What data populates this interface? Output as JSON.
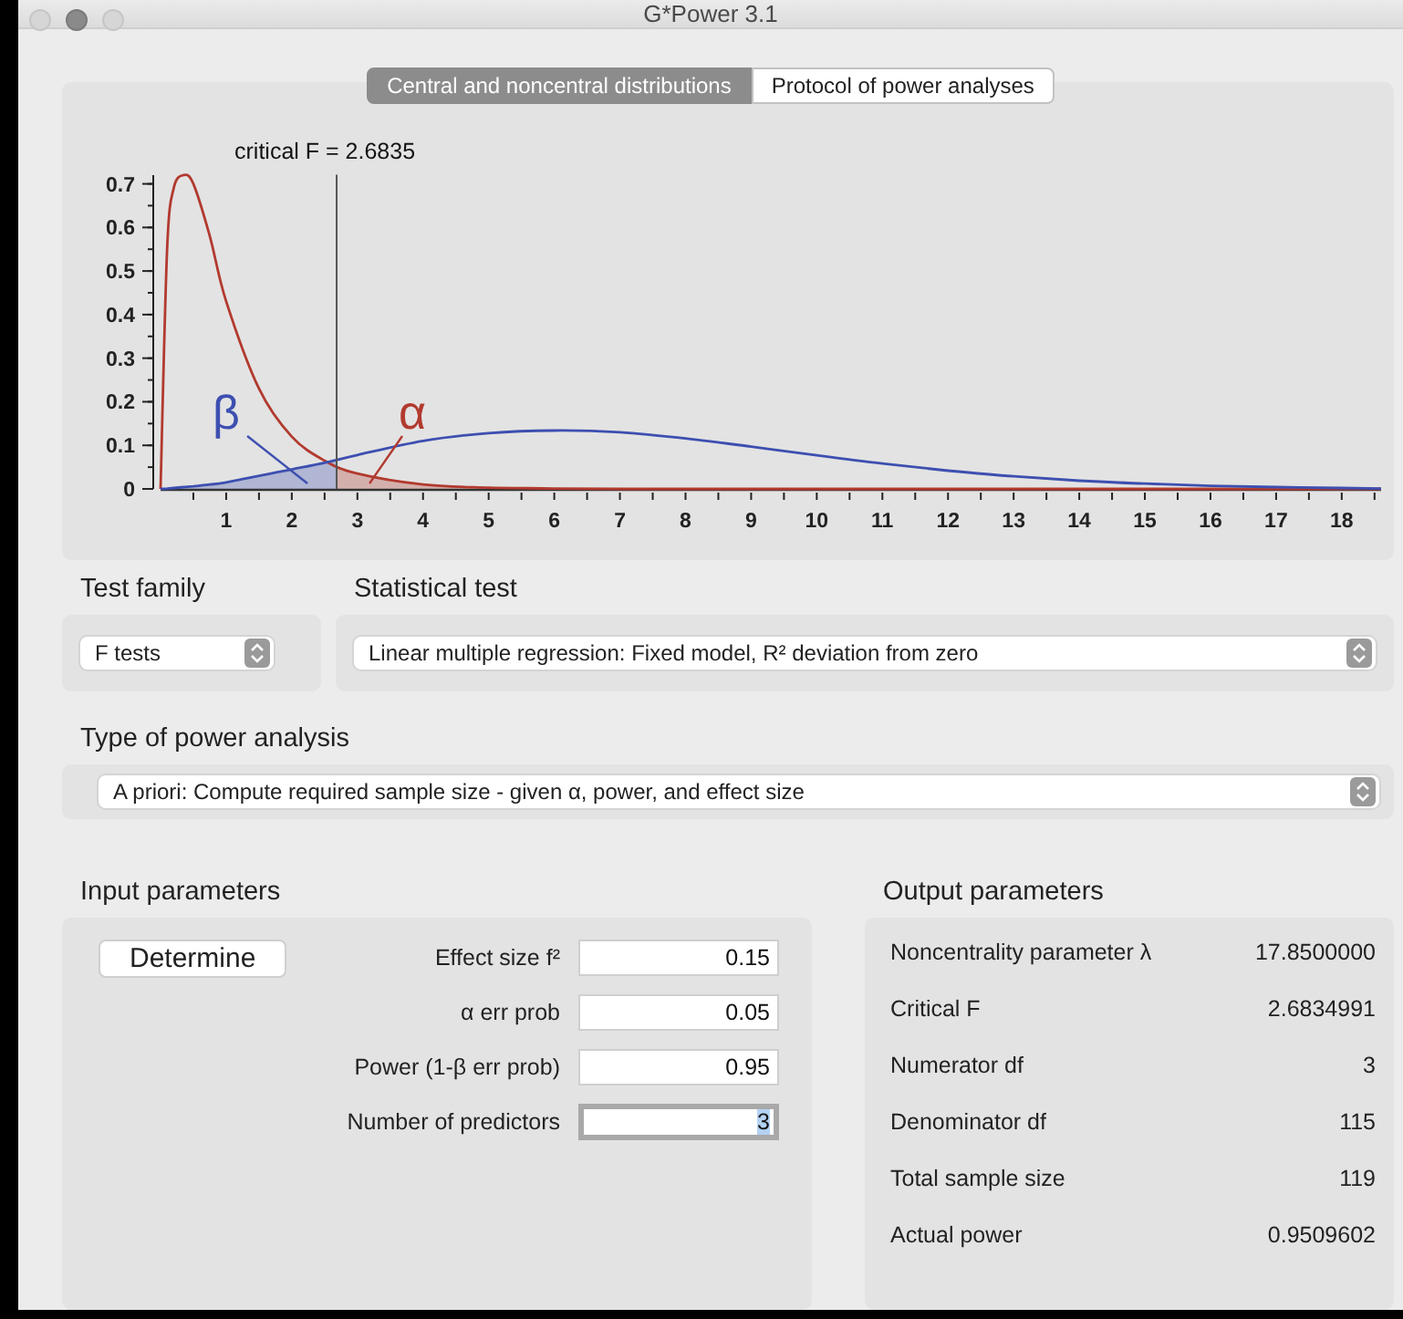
{
  "window": {
    "title": "G*Power 3.1"
  },
  "tabs": [
    {
      "label": "Central and noncentral distributions",
      "selected": true
    },
    {
      "label": "Protocol of power analyses",
      "selected": false
    }
  ],
  "chart_data": {
    "type": "line",
    "x": [
      0,
      0.1,
      0.2,
      0.35,
      0.5,
      0.75,
      1,
      1.5,
      2,
      2.5,
      3,
      4,
      5,
      6,
      7,
      8,
      9,
      10,
      11,
      12,
      13,
      14,
      15,
      16,
      17,
      18,
      18.6
    ],
    "series": [
      {
        "color": "#b23a2f",
        "values": [
          0,
          0.55,
          0.69,
          0.72,
          0.7,
          0.58,
          0.43,
          0.23,
          0.12,
          0.065,
          0.035,
          0.01,
          0.003,
          0.001,
          0,
          0,
          0,
          0,
          0,
          0,
          0,
          0,
          0,
          0,
          0,
          0,
          0
        ]
      },
      {
        "color": "#3d4fb0",
        "values": [
          0,
          0.001,
          0.002,
          0.004,
          0.006,
          0.01,
          0.015,
          0.03,
          0.045,
          0.06,
          0.078,
          0.11,
          0.128,
          0.134,
          0.13,
          0.116,
          0.097,
          0.077,
          0.058,
          0.042,
          0.029,
          0.019,
          0.012,
          0.007,
          0.004,
          0.002,
          0.001
        ]
      }
    ],
    "xlim": [
      0,
      18.6
    ],
    "ylim": [
      0,
      0.72
    ],
    "xticks": [
      1,
      2,
      3,
      4,
      5,
      6,
      7,
      8,
      9,
      10,
      11,
      12,
      13,
      14,
      15,
      16,
      17,
      18
    ],
    "yticks": [
      0,
      0.1,
      0.2,
      0.3,
      0.4,
      0.5,
      0.6,
      0.7
    ],
    "ref_lines": [
      {
        "axis": "x",
        "value": 2.6835
      }
    ],
    "annotations": [
      "critical F = 2.6835",
      "β",
      "α"
    ]
  },
  "test_family": {
    "label": "Test family",
    "value": "F tests"
  },
  "statistical_test": {
    "label": "Statistical test",
    "value": "Linear multiple regression: Fixed model, R² deviation from zero"
  },
  "power_analysis_type": {
    "label": "Type of power analysis",
    "value": "A priori: Compute required sample size - given α, power, and effect size"
  },
  "input_parameters": {
    "title": "Input parameters",
    "button": "Determine",
    "fields": [
      {
        "label": "Effect size f²",
        "value": "0.15",
        "focused": false
      },
      {
        "label": "α err prob",
        "value": "0.05",
        "focused": false
      },
      {
        "label": "Power (1-β err prob)",
        "value": "0.95",
        "focused": false
      },
      {
        "label": "Number of predictors",
        "value": "3",
        "focused": true
      }
    ]
  },
  "output_parameters": {
    "title": "Output parameters",
    "rows": [
      {
        "label": "Noncentrality parameter λ",
        "value": "17.8500000"
      },
      {
        "label": "Critical F",
        "value": "2.6834991"
      },
      {
        "label": "Numerator df",
        "value": "3"
      },
      {
        "label": "Denominator df",
        "value": "115"
      },
      {
        "label": "Total sample size",
        "value": "119"
      },
      {
        "label": "Actual power",
        "value": "0.9509602"
      }
    ]
  }
}
